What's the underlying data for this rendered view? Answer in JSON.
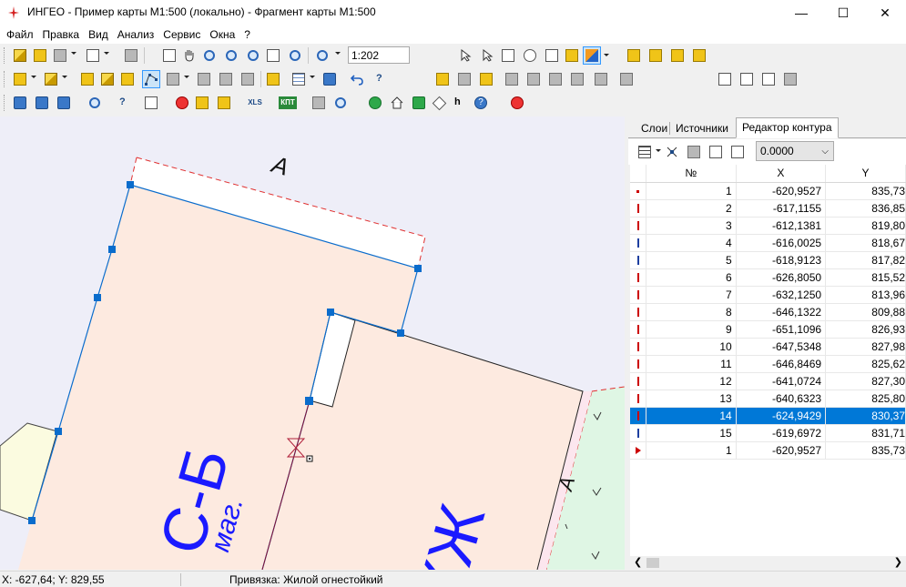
{
  "window": {
    "title": "ИНГЕО - Пример карты М1:500 (локально) - Фрагмент карты М1:500",
    "min_glyph": "—",
    "max_glyph": "☐",
    "close_glyph": "✕"
  },
  "menu": [
    "Файл",
    "Правка",
    "Вид",
    "Анализ",
    "Сервис",
    "Окна",
    "?"
  ],
  "toolbar": {
    "scale_value": "1:202",
    "xls_label": "XLS",
    "kpt_label": "КПТ"
  },
  "map": {
    "label_a_top": "А",
    "label_a_right": "А",
    "label_sb": "С-Б",
    "label_mag": "маг.",
    "label_kzh": "КЖ"
  },
  "panel": {
    "tabs": [
      "Слои",
      "Источники",
      "Редактор контура"
    ],
    "active_tab": "Редактор контура",
    "offset_value": "0.0000",
    "columns": [
      "№",
      "X",
      "Y"
    ],
    "rows": [
      {
        "n": "1",
        "x": "-620,9527",
        "y": "835,73"
      },
      {
        "n": "2",
        "x": "-617,1155",
        "y": "836,85"
      },
      {
        "n": "3",
        "x": "-612,1381",
        "y": "819,80"
      },
      {
        "n": "4",
        "x": "-616,0025",
        "y": "818,67"
      },
      {
        "n": "5",
        "x": "-618,9123",
        "y": "817,82"
      },
      {
        "n": "6",
        "x": "-626,8050",
        "y": "815,52"
      },
      {
        "n": "7",
        "x": "-632,1250",
        "y": "813,96"
      },
      {
        "n": "8",
        "x": "-646,1322",
        "y": "809,88"
      },
      {
        "n": "9",
        "x": "-651,1096",
        "y": "826,93"
      },
      {
        "n": "10",
        "x": "-647,5348",
        "y": "827,98"
      },
      {
        "n": "11",
        "x": "-646,8469",
        "y": "825,62"
      },
      {
        "n": "12",
        "x": "-641,0724",
        "y": "827,30"
      },
      {
        "n": "13",
        "x": "-640,6323",
        "y": "825,80"
      },
      {
        "n": "14",
        "x": "-624,9429",
        "y": "830,37"
      },
      {
        "n": "15",
        "x": "-619,6972",
        "y": "831,71"
      },
      {
        "n": "1",
        "x": "-620,9527",
        "y": "835,73"
      }
    ],
    "selected_row_number": "14"
  },
  "status": {
    "coords": "X: -627,64; Y: 829,55",
    "snap": "Привязка: Жилой огнестойкий"
  },
  "colors": {
    "selection": "#0078d7",
    "map_background": "#eeeef8",
    "parcel_fill": "#fdeae0",
    "label_blue": "#1a1aff",
    "dashed_red": "#e03030",
    "vertex_blue": "#0a6ccc"
  }
}
